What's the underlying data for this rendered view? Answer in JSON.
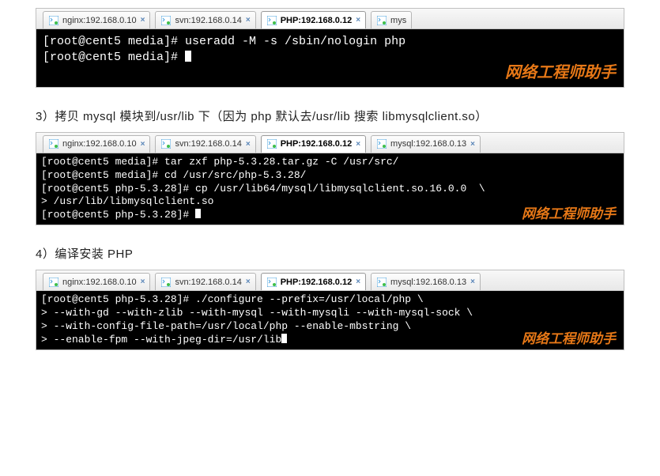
{
  "tabs": [
    {
      "label": "nginx:192.168.0.10"
    },
    {
      "label": "svn:192.168.0.14"
    },
    {
      "label": "PHP:192.168.0.12"
    },
    {
      "label": "mysql:192.168.0.13"
    }
  ],
  "tab_short_mysql": "mys",
  "watermark": "网络工程师助手",
  "section1": {
    "line1": "[root@cent5 media]# useradd -M -s /sbin/nologin php",
    "line2": "[root@cent5 media]# "
  },
  "section3": {
    "title": "3）拷贝 mysql 模块到/usr/lib 下（因为 php 默认去/usr/lib 搜索 libmysqlclient.so）",
    "l1": "[root@cent5 media]# tar zxf php-5.3.28.tar.gz -C /usr/src/",
    "l2": "[root@cent5 media]# cd /usr/src/php-5.3.28/",
    "l3": "[root@cent5 php-5.3.28]# cp /usr/lib64/mysql/libmysqlclient.so.16.0.0  \\",
    "l4": "> /usr/lib/libmysqlclient.so",
    "l5": "[root@cent5 php-5.3.28]# "
  },
  "section4": {
    "title": "4）编译安装 PHP",
    "l1": "[root@cent5 php-5.3.28]# ./configure --prefix=/usr/local/php \\",
    "l2": "> --with-gd --with-zlib --with-mysql --with-mysqli --with-mysql-sock \\",
    "l3": "> --with-config-file-path=/usr/local/php --enable-mbstring \\",
    "l4": "> --enable-fpm --with-jpeg-dir=/usr/lib"
  }
}
